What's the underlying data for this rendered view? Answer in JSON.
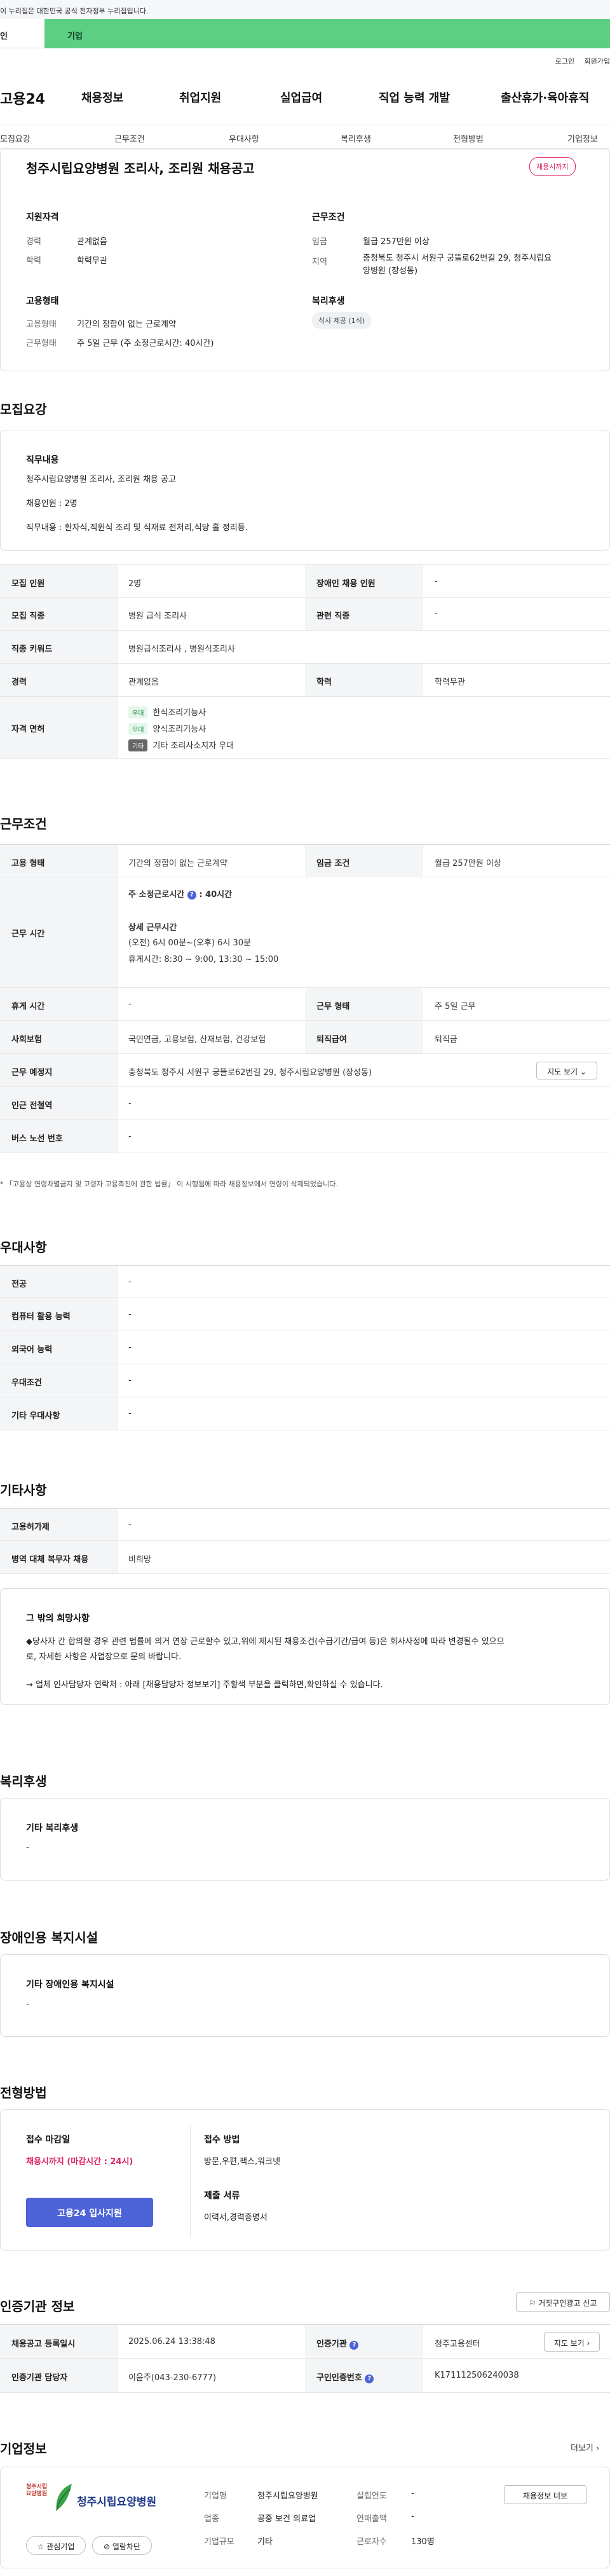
{
  "gov_notice": "이 누리집은 대한민국 공식 전자정부 누리집입니다.",
  "top_tabs": {
    "individual": "인",
    "business": "기업"
  },
  "util": {
    "login": "로그인",
    "join": "회원가입"
  },
  "logo": "고용24",
  "gnb": [
    "채용정보",
    "취업지원",
    "실업급여",
    "직업 능력 개발",
    "출산휴가·육아휴직"
  ],
  "lnb": [
    "모집요강",
    "근무조건",
    "우대사항",
    "복리후생",
    "전형방법",
    "기업정보"
  ],
  "summary": {
    "title": "청주시립요양병원 조리사, 조리원 채용공고",
    "badge": "채용시까지",
    "qual_title": "지원자격",
    "career_label": "경력",
    "career_value": "관계없음",
    "edu_label": "학력",
    "edu_value": "학력무관",
    "emp_title": "고용형태",
    "emptype_label": "고용형태",
    "emptype_value": "기간의 정함이 없는 근로계약",
    "worktype_label": "근무형태",
    "worktype_value": "주 5일 근무 (주 소정근로시간: 40시간)",
    "cond_title": "근무조건",
    "wage_label": "임금",
    "wage_value": "월급 257만원 이상",
    "region_label": "지역",
    "region_value_1": "충청북도 청주시 서원구 궁뜰로62번길 29, 청주시립요",
    "region_value_2": "양병원 (장성동)",
    "welfare_title": "복리후생",
    "welfare_tag": "식사 제공 (1식)"
  },
  "recruit": {
    "section": "모집요강",
    "job_title": "직무내용",
    "job_line1": "청주시립요양병원 조리사, 조리원 채용 공고",
    "job_line2": "채용인원 : 2명",
    "job_line3": "직무내용 : 환자식,직원식 조리 및 식재료 전처리,식당 홀 정리등.",
    "rows": {
      "count_label": "모집 인원",
      "count_value": "2명",
      "disabled_label": "장애인 채용 인원",
      "disabled_value": "-",
      "jobtype_label": "모집 직종",
      "jobtype_value": "병원 급식 조리사",
      "related_label": "관련 직종",
      "related_value": "-",
      "keyword_label": "직종 키워드",
      "keyword_value": "병원급식조리사 , 병원식조리사",
      "career_label": "경력",
      "career_value": "관계없음",
      "edu_label": "학력",
      "edu_value": "학력무관",
      "license_label": "자격 면허",
      "licenses": [
        {
          "tag": "우대",
          "name": "한식조리기능사"
        },
        {
          "tag": "우대",
          "name": "양식조리기능사"
        },
        {
          "tag": "기타",
          "name": "기타 조리사소지자 우대"
        }
      ]
    }
  },
  "work": {
    "section": "근무조건",
    "emp_label": "고용 형태",
    "emp_value": "기간의 정함이 없는 근로계약",
    "wage_label": "임금 조건",
    "wage_value": "월급 257만원 이상",
    "time_label": "근무 시간",
    "weekly_label": "주 소정근로시간",
    "weekly_value": ": 40시간",
    "detail_title": "상세 근무시간",
    "detail_1": "(오전) 6시 00분~(오후) 6시 30분",
    "detail_2": "휴게시간: 8:30 ~ 9:00,  13:30 ~ 15:00",
    "holiday_label": "휴게 시간",
    "holiday_value": "-",
    "shift_label": "근무 형태",
    "shift_value": "주 5일 근무",
    "insurance_label": "사회보험",
    "insurance_value": "국민연금, 고용보험, 산재보험, 건강보험",
    "retire_label": "퇴직급여",
    "retire_value": "퇴직금",
    "place_label": "근무 예정지",
    "place_value": "충청북도 청주시 서원구 궁뜰로62번길 29, 청주시립요양병원 (장성동)",
    "map_btn": "지도 보기",
    "subway_label": "인근 전철역",
    "subway_value": "-",
    "bus_label": "버스 노선 번호",
    "bus_value": "-",
    "footnote": "「고용상 연령차별금지 및 고령자 고용촉진에 관한 법률」 이 시행됨에 따라 채용정보에서 연령이 삭제되었습니다."
  },
  "pref": {
    "section": "우대사항",
    "major_label": "전공",
    "major_value": "-",
    "pc_label": "컴퓨터 활용 능력",
    "pc_value": "-",
    "lang_label": "외국어 능력",
    "lang_value": "-",
    "cond_label": "우대조건",
    "cond_value": "-",
    "etc_label": "기타 우대사항",
    "etc_value": "-"
  },
  "etc": {
    "section": "기타사항",
    "welfare_label": "고용허가제",
    "welfare_value": "-",
    "military_label": "병역 대체 복무자 채용",
    "military_value": "비희망",
    "box_title": "그 밖의 희망사항",
    "box_line1": "◆당사자 간 합의할 경우 관련 법률에 의거 연장 근로할수 있고,위에 제시된 채용조건(수급기간/급여 등)은 회사사정에 따라 변경될수 있으므",
    "box_line2": "로, 자세한 사항은 사업장으로 문의 바랍니다.",
    "box_line3": "→ 업체 인사담당자 연락처 : 아래 [채용담당자 정보보기] 주황색 부분을 클릭하면,확인하실 수 있습니다."
  },
  "welfare": {
    "section": "복리후생",
    "box_title": "기타 복리후생",
    "box_value": "-"
  },
  "disabled": {
    "section": "장애인용 복지시설",
    "box_title": "기타 장애인용 복지시설",
    "box_value": "-"
  },
  "selection": {
    "section": "전형방법",
    "deadline_title": "접수 마감일",
    "deadline_value": "채용시까지 (마감시간 : 24시)",
    "apply_btn": "고용24 입사지원",
    "method_title": "접수 방법",
    "method_value": "방문,우편,팩스,워크넷",
    "docs_title": "제출 서류",
    "docs_value": "이력서,경력증명서"
  },
  "agency": {
    "section": "인증기관 정보",
    "report_btn": "거짓구인광고 신고",
    "reg_label": "채용공고 등록일시",
    "reg_value": "2025.06.24 13:38:48",
    "org_label": "인증기관",
    "org_value": "청주고용센터",
    "map_btn": "지도 보기",
    "manager_label": "인증기관 담당자",
    "manager_value": "이윤주(043-230-6777)",
    "jobno_label": "구인인증번호",
    "jobno_value": "K171112506240038"
  },
  "company": {
    "section": "기업정보",
    "more": "더보기",
    "logo_small": "청주시립요양병원",
    "logo_text": "청주시립요양병원",
    "fav_btn": "관심기업",
    "block_btn": "열람차단",
    "name_label": "기업명",
    "name_value": "청주시립요양병원",
    "industry_label": "업종",
    "industry_value": "공중 보건 의료업",
    "size_label": "기업규모",
    "size_value": "기타",
    "founded_label": "설립연도",
    "founded_value": "-",
    "sales_label": "연매출액",
    "sales_value": "-",
    "staff_label": "근로자수",
    "staff_value": "130명",
    "info_btn": "채용정보 더보",
    "colors": {
      "accent_green": "#5ccf85",
      "accent_red": "#e0245e",
      "accent_blue": "#4d63d8"
    }
  }
}
